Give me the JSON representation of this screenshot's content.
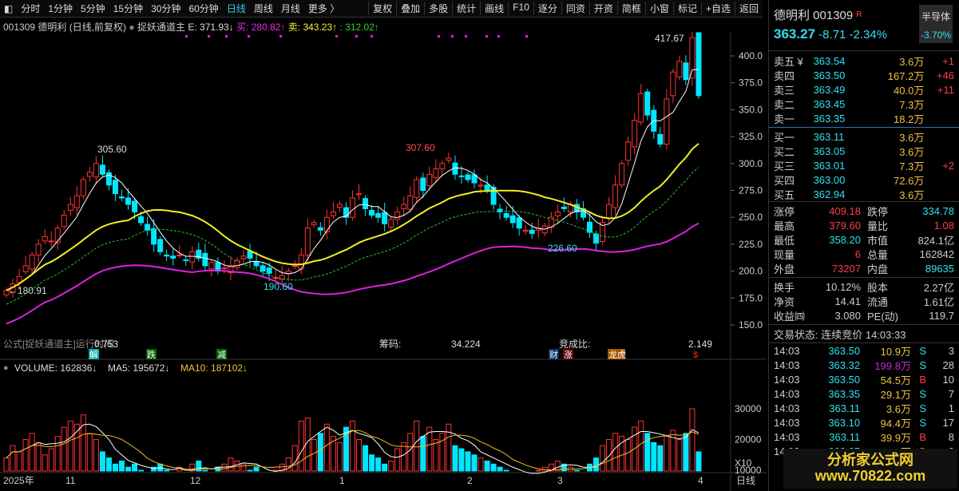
{
  "toolbar": {
    "periods": [
      "分时",
      "1分钟",
      "5分钟",
      "15分钟",
      "30分钟",
      "60分钟",
      "日线",
      "周线",
      "月线",
      "更多 〉"
    ],
    "active": "日线",
    "tools": [
      "复权",
      "叠加",
      "多股",
      "统计",
      "画线",
      "F10",
      "逐分",
      "同资",
      "开资",
      "简框",
      "小窗",
      "标记",
      "+自选",
      "返回"
    ]
  },
  "info": {
    "title": "001309 德明利 (日线,前复权)",
    "indicator": "捉妖通道主",
    "e": "E: 371.93↓",
    "buy": "买: 280.82↑",
    "sell": "卖: 343.23↑",
    "x": ": 312.02↑"
  },
  "chart": {
    "high_label": "417.67",
    "labels": [
      "305.60",
      "307.60",
      "190.60",
      "226.60",
      "←180.91"
    ],
    "price_ticks": [
      "400.0",
      "375.0",
      "350.0",
      "325.0",
      "300.0",
      "275.0",
      "250.0",
      "225.0",
      "200.0",
      "175.0",
      "150.0"
    ],
    "vol_ticks": [
      "30000",
      "20000",
      "10000",
      "X10"
    ],
    "x_labels": [
      "2025年",
      "11",
      "12",
      "1",
      "2",
      "3",
      "4",
      "日线"
    ],
    "formula": "公式[捉妖通道主]运行时间",
    "formula_val": "0.753",
    "chip_label": "筹码:",
    "chip_val": "34.224",
    "bid_label": "竞成比:",
    "bid_val": "2.149",
    "markers": [
      "解",
      "跌",
      "减",
      "财",
      "涨",
      "龙虎",
      "$"
    ],
    "vol_legend": {
      "volume": "VOLUME: 162836↓",
      "ma5": "MA5: 195672↓",
      "ma10": "MA10: 187102↓"
    },
    "closes": [
      182,
      188,
      195,
      205,
      215,
      225,
      232,
      228,
      240,
      252,
      262,
      270,
      285,
      292,
      300,
      290,
      280,
      272,
      268,
      262,
      255,
      245,
      238,
      225,
      218,
      214,
      212,
      215,
      210,
      218,
      212,
      205,
      208,
      200,
      203,
      205,
      210,
      214,
      212,
      205,
      200,
      198,
      194,
      196,
      200,
      205,
      215,
      240,
      245,
      238,
      250,
      255,
      262,
      250,
      268,
      272,
      258,
      252,
      250,
      244,
      248,
      255,
      262,
      270,
      285,
      275,
      290,
      295,
      300,
      305,
      290,
      288,
      285,
      282,
      280,
      275,
      262,
      255,
      250,
      245,
      240,
      238,
      235,
      240,
      242,
      250,
      255,
      258,
      262,
      255,
      250,
      236,
      226,
      245,
      262,
      280,
      300,
      320,
      340,
      365,
      345,
      330,
      318,
      360,
      385,
      395,
      378,
      417,
      363
    ],
    "volumes": [
      14,
      18,
      16,
      20,
      22,
      19,
      15,
      17,
      21,
      24,
      26,
      25,
      28,
      22,
      20,
      16,
      14,
      12,
      13,
      11,
      12,
      10,
      9,
      11,
      12,
      10,
      9,
      11,
      8,
      12,
      13,
      10,
      9,
      11,
      12,
      14,
      13,
      12,
      10,
      11,
      9,
      8,
      10,
      12,
      14,
      18,
      26,
      27,
      20,
      22,
      25,
      21,
      19,
      24,
      26,
      20,
      18,
      15,
      14,
      12,
      13,
      17,
      19,
      22,
      26,
      21,
      24,
      20,
      22,
      25,
      18,
      17,
      16,
      15,
      14,
      13,
      12,
      11,
      10,
      9,
      9,
      8,
      9,
      10,
      11,
      12,
      13,
      12,
      11,
      10,
      9,
      12,
      14,
      18,
      20,
      22,
      21,
      20,
      24,
      26,
      22,
      19,
      18,
      21,
      23,
      20,
      22,
      30,
      16
    ]
  },
  "quote": {
    "name": "德明利 001309",
    "tag": "R",
    "sector": "半导体",
    "sector_chg": "-3.70%",
    "price": "363.27",
    "chg": "-8.71",
    "pct": "-2.34%"
  },
  "asks": [
    [
      "卖五 ¥",
      "363.54",
      "3.6万",
      "+1"
    ],
    [
      "卖四",
      "363.50",
      "167.2万",
      "+46"
    ],
    [
      "卖三",
      "363.49",
      "40.0万",
      "+11"
    ],
    [
      "卖二",
      "363.45",
      "7.3万",
      ""
    ],
    [
      "卖一",
      "363.35",
      "18.2万",
      ""
    ]
  ],
  "bids": [
    [
      "买一",
      "363.11",
      "3.6万",
      ""
    ],
    [
      "买二",
      "363.05",
      "3.6万",
      ""
    ],
    [
      "买三",
      "363.01",
      "7.3万",
      "+2"
    ],
    [
      "买四",
      "363.00",
      "72.6万",
      ""
    ],
    [
      "买五",
      "362.94",
      "3.6万",
      ""
    ]
  ],
  "stats": [
    [
      "涨停",
      "409.18",
      "跌停",
      "334.78"
    ],
    [
      "最高",
      "379.60",
      "量比",
      "1.08"
    ],
    [
      "最低",
      "358.20",
      "市值",
      "824.1亿"
    ],
    [
      "现量",
      "6",
      "总量",
      "162842"
    ],
    [
      "外盘",
      "73207",
      "内盘",
      "89635"
    ]
  ],
  "stats2": [
    [
      "换手",
      "10.12%",
      "股本",
      "2.27亿"
    ],
    [
      "净资",
      "14.41",
      "流通",
      "1.61亿"
    ],
    [
      "收益㈣",
      "3.080",
      "PE(动)",
      "119.7"
    ]
  ],
  "status": "交易状态: 连续竞价 14:03:33",
  "ticks": [
    [
      "14:03",
      "363.50",
      "10.9万",
      "S",
      "3"
    ],
    [
      "14:03",
      "363.32",
      "199.8万",
      "S",
      "28"
    ],
    [
      "14:03",
      "363.50",
      "54.5万",
      "B",
      "10"
    ],
    [
      "14:03",
      "363.35",
      "29.1万",
      "S",
      "7"
    ],
    [
      "14:03",
      "363.11",
      "3.6万",
      "S",
      "1"
    ],
    [
      "14:03",
      "363.10",
      "94.4万",
      "S",
      "17"
    ],
    [
      "14:03",
      "363.11",
      "39.9万",
      "B",
      "8"
    ],
    [
      "14:03",
      "363.27",
      "7.3万",
      "B",
      "2"
    ]
  ],
  "logo": "分析家公式网 www.70822.com"
}
